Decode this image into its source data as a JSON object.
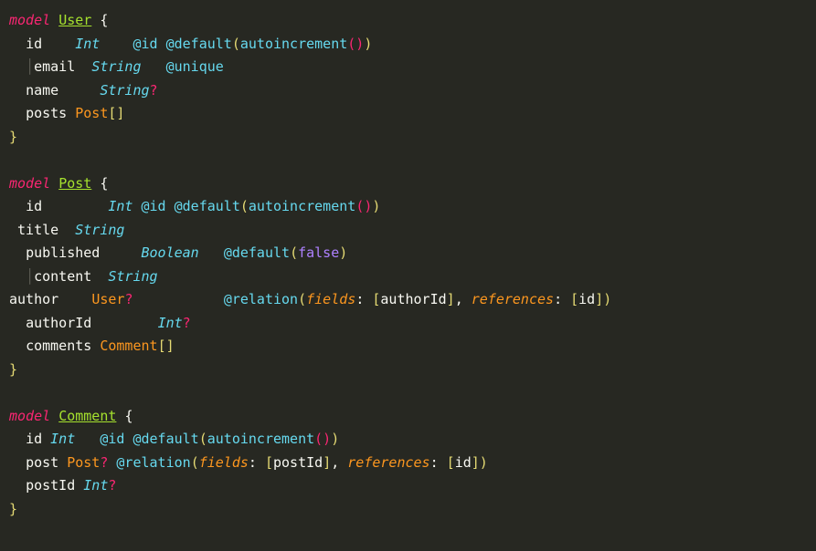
{
  "models": [
    {
      "keyword": "model",
      "name": "User",
      "open": "{",
      "fields": [
        {
          "indent": "  ",
          "name": "id",
          "spacing": "    ",
          "type": "Int",
          "spacing2": "    ",
          "attrs": "@id @default",
          "paren_open": "(",
          "func": "autoincrement",
          "inner_paren": "()",
          "paren_close": ")"
        },
        {
          "indent": "   ",
          "guide": "",
          "name": "email",
          "spacing": "  ",
          "type": "String",
          "spacing2": "   ",
          "attrs": "@unique"
        },
        {
          "indent": "  ",
          "name": "name",
          "spacing": "     ",
          "type": "String",
          "optional": "?"
        },
        {
          "indent": "  ",
          "name": "posts",
          "spacing": " ",
          "usertype": "Post",
          "brackets": "[]"
        }
      ],
      "close": "}"
    },
    {
      "keyword": "model",
      "name": "Post",
      "open": "{",
      "fields": [
        {
          "indent": "  ",
          "name": "id",
          "spacing": "        ",
          "type": "Int",
          "spacing2": " ",
          "attrs": "@id @default",
          "paren_open": "(",
          "func": "autoincrement",
          "inner_paren": "()",
          "paren_close": ")"
        },
        {
          "indent": " ",
          "name": "title",
          "spacing": "  ",
          "type": "String"
        },
        {
          "indent": "  ",
          "name": "published",
          "spacing": "     ",
          "type": "Boolean",
          "spacing2": "   ",
          "attrs": "@default",
          "paren_open": "(",
          "false": "false",
          "paren_close": ")"
        },
        {
          "indent": "   ",
          "name": "content",
          "spacing": "  ",
          "type": "String"
        },
        {
          "indent": "",
          "name": "author",
          "spacing": "    ",
          "usertype": "User",
          "optional": "?",
          "spacing2": "           ",
          "attrs": "@relation",
          "paren_open": "(",
          "param1": "fields",
          "colon1": ":",
          "bracket1_open": " [",
          "ref1": "authorId",
          "bracket1_close": "]",
          "comma": ",",
          "param2": " references",
          "colon2": ":",
          "bracket2_open": " [",
          "ref2": "id",
          "bracket2_close": "]",
          "paren_close": ")"
        },
        {
          "indent": "  ",
          "name": "authorId",
          "spacing": "        ",
          "type": "Int",
          "optional": "?"
        },
        {
          "indent": "  ",
          "name": "comments",
          "spacing": " ",
          "usertype": "Comment",
          "brackets": "[]"
        }
      ],
      "close": "}"
    },
    {
      "keyword": "model",
      "name": "Comment",
      "open": "{",
      "fields": [
        {
          "indent": "  ",
          "name": "id",
          "spacing": " ",
          "type": "Int",
          "spacing2": "   ",
          "attrs": "@id @default",
          "paren_open": "(",
          "func": "autoincrement",
          "inner_paren": "()",
          "paren_close": ")"
        },
        {
          "indent": "  ",
          "name": "post",
          "spacing": " ",
          "usertype": "Post",
          "optional": "?",
          "spacing2": " ",
          "attrs": "@relation",
          "paren_open": "(",
          "param1": "fields",
          "colon1": ":",
          "bracket1_open": " [",
          "ref1": "postId",
          "bracket1_close": "]",
          "comma": ",",
          "param2": " references",
          "colon2": ":",
          "bracket2_open": " [",
          "ref2": "id",
          "bracket2_close": "]",
          "paren_close": ")"
        },
        {
          "indent": "  ",
          "name": "postId",
          "spacing": " ",
          "type": "Int",
          "optional": "?"
        }
      ],
      "close": "}"
    }
  ]
}
